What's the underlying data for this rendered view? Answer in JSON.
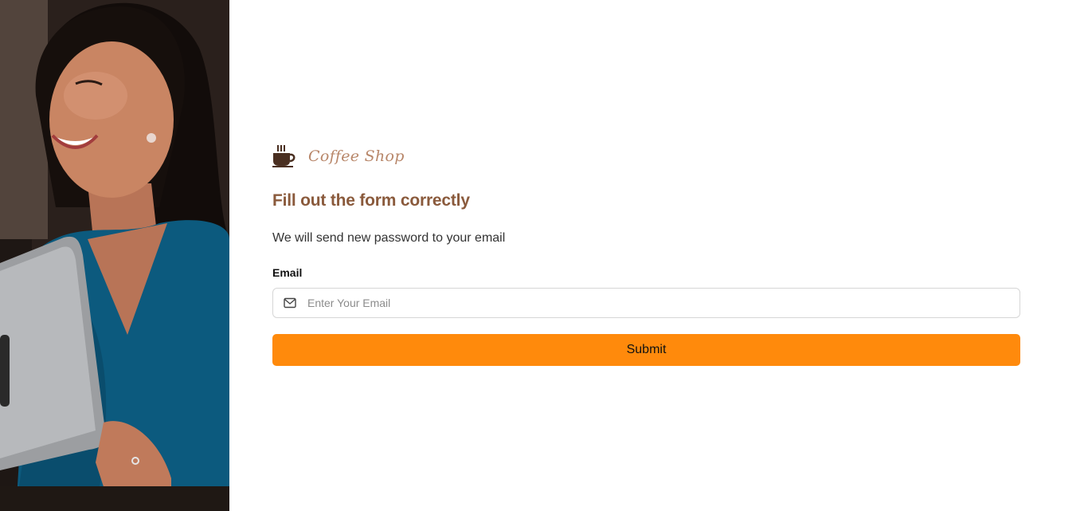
{
  "brand": {
    "name": "Coffee Shop",
    "icon": "coffee-cup-icon"
  },
  "form": {
    "heading": "Fill out the form correctly",
    "subtitle": "We will send new password to your email",
    "email_label": "Email",
    "email_placeholder": "Enter Your Email",
    "email_value": "",
    "email_icon": "mail-icon",
    "submit_label": "Submit"
  },
  "colors": {
    "accent": "#ff8a0c",
    "heading": "#8a5a3c",
    "brand": "#b8876a"
  }
}
